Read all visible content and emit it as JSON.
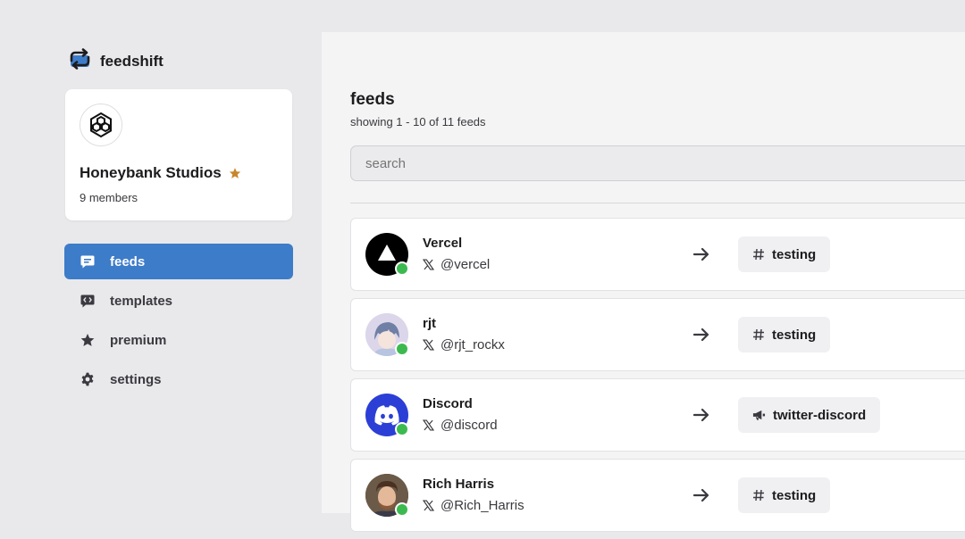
{
  "brand": {
    "name": "feedshift"
  },
  "org": {
    "name": "Honeybank Studios",
    "members": "9 members"
  },
  "nav": [
    {
      "label": "feeds",
      "icon": "message-square-icon",
      "active": true
    },
    {
      "label": "templates",
      "icon": "code-message-icon",
      "active": false
    },
    {
      "label": "premium",
      "icon": "star-icon",
      "active": false
    },
    {
      "label": "settings",
      "icon": "gear-icon",
      "active": false
    }
  ],
  "main": {
    "title": "feeds",
    "subtitle": "showing 1 - 10 of 11 feeds",
    "search_placeholder": "search"
  },
  "feeds": [
    {
      "name": "Vercel",
      "handle": "@vercel",
      "channel": "testing",
      "channel_icon": "hash-icon",
      "status": "online"
    },
    {
      "name": "rjt",
      "handle": "@rjt_rockx",
      "channel": "testing",
      "channel_icon": "hash-icon",
      "status": "online"
    },
    {
      "name": "Discord",
      "handle": "@discord",
      "channel": "twitter-discord",
      "channel_icon": "megaphone-icon",
      "status": "online"
    },
    {
      "name": "Rich Harris",
      "handle": "@Rich_Harris",
      "channel": "testing",
      "channel_icon": "hash-icon",
      "status": "online"
    }
  ],
  "colors": {
    "accent": "#3d7cc9",
    "online": "#3cba4f",
    "star": "#c8862a"
  }
}
